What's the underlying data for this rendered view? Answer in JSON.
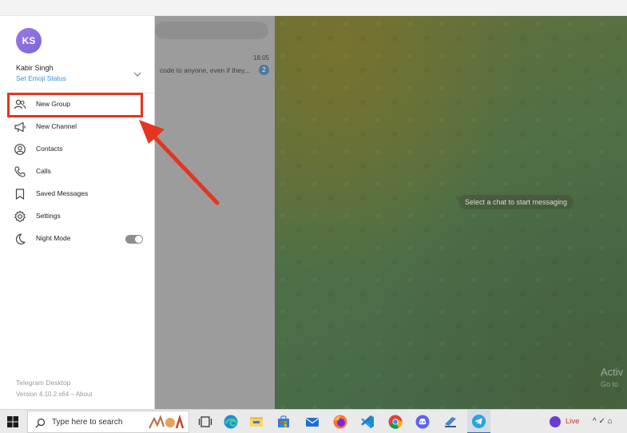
{
  "profile": {
    "initials": "KS",
    "name": "Kabir Singh",
    "emoji_status": "Set Emoji Status"
  },
  "menu": [
    {
      "label": "New Group",
      "icon": "people-icon"
    },
    {
      "label": "New Channel",
      "icon": "megaphone-icon"
    },
    {
      "label": "Contacts",
      "icon": "contact-icon"
    },
    {
      "label": "Calls",
      "icon": "phone-icon"
    },
    {
      "label": "Saved Messages",
      "icon": "bookmark-icon"
    },
    {
      "label": "Settings",
      "icon": "gear-icon"
    },
    {
      "label": "Night Mode",
      "icon": "moon-icon"
    }
  ],
  "night_mode_on": false,
  "footer": {
    "app_name": "Telegram Desktop",
    "version": "Version 4.10.2 x64 – About"
  },
  "chat_list": {
    "time": "18:05",
    "preview": "code to anyone, even if they...",
    "badge": "2"
  },
  "chat_area": {
    "placeholder": "Select a chat to start messaging",
    "watermark_line1": "Activ",
    "watermark_line2": "Go to"
  },
  "taskbar": {
    "search_placeholder": "Type here to search",
    "live_label": "Live",
    "tray_text": "^ ✓ ⌂"
  },
  "colors": {
    "accent": "#3a8cd6",
    "highlight": "#e53420",
    "avatar": "#8b6fe0"
  }
}
